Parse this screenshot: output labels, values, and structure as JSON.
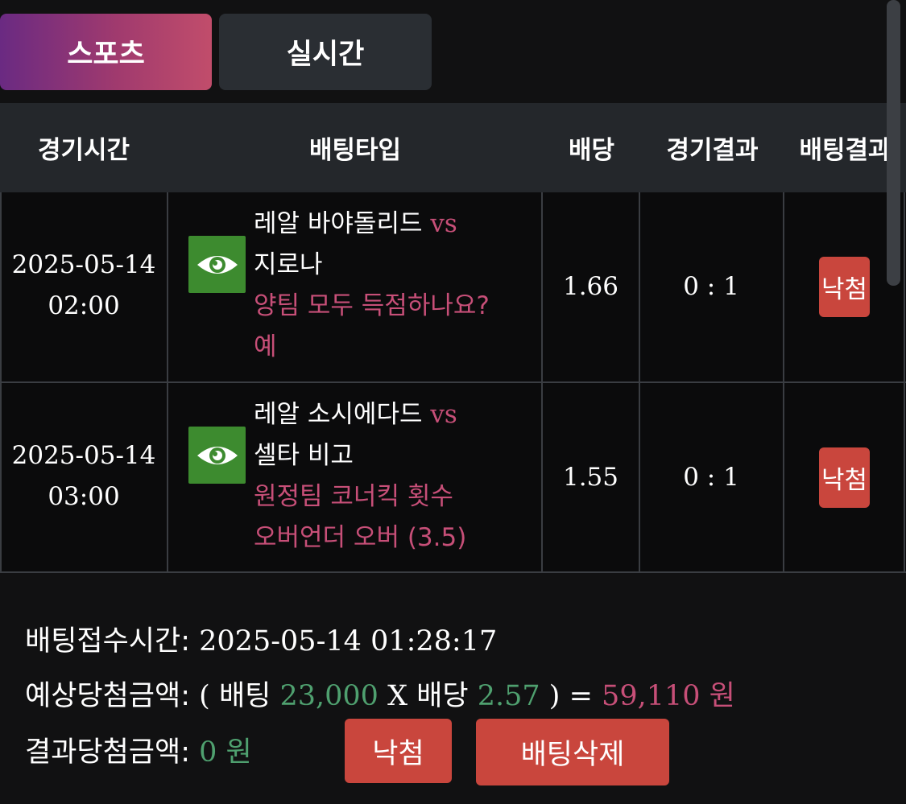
{
  "tabs": [
    {
      "label": "스포츠",
      "active": true
    },
    {
      "label": "실시간",
      "active": false
    }
  ],
  "table": {
    "headers": [
      "경기시간",
      "배팅타입",
      "배당",
      "경기결과",
      "배팅결과"
    ],
    "rows": [
      {
        "date": "2025-05-14",
        "time": "02:00",
        "team_home": "레알 바야돌리드",
        "vs": "vs",
        "team_away": "지로나",
        "market": "양팀 모두 득점하나요?",
        "pick": "예",
        "odds": "1.66",
        "score": "0 : 1",
        "result": "낙첨"
      },
      {
        "date": "2025-05-14",
        "time": "03:00",
        "team_home": "레알 소시에다드",
        "vs": "vs",
        "team_away": "셀타 비고",
        "market": "원정팀 코너킥 횟수",
        "pick": "오버언더 오버 (3.5)",
        "odds": "1.55",
        "score": "0 : 1",
        "result": "낙첨"
      }
    ]
  },
  "summary": {
    "bet_time_label": "배팅접수시간:",
    "bet_time_value": "2025-05-14 01:28:17",
    "expected_label": "예상당첨금액:",
    "open_paren": "(",
    "bet_word": "배팅",
    "bet_amount": "23,000",
    "x": "X",
    "odds_word": "배당",
    "total_odds": "2.57",
    "close_paren": ")",
    "equals": "=",
    "expected_amount": "59,110 원",
    "result_label": "결과당첨금액:",
    "result_amount": "0 원"
  },
  "buttons": {
    "status": "낙첨",
    "delete": "배팅삭제"
  },
  "colors": {
    "accent_pink": "#c74f78",
    "accent_green": "#4fa06f",
    "lose_red": "#c9463d",
    "eye_green": "#3d8b2f"
  },
  "icons": {
    "view": "eye-icon"
  }
}
